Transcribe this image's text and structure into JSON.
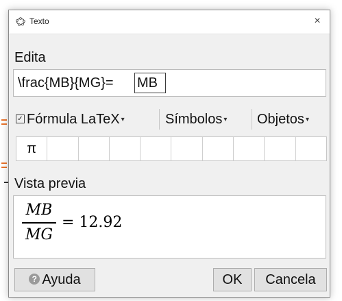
{
  "window": {
    "title": "Texto",
    "close_symbol": "×"
  },
  "edit": {
    "label": "Edita",
    "latex_text": "\\frac{MB}{MG}=",
    "object_text": "MB"
  },
  "toolbar": {
    "latex_checkbox_checked": true,
    "latex_label": "Fórmula LaTeX",
    "symbols_label": "Símbolos",
    "objects_label": "Objetos",
    "caret_symbol": "▾"
  },
  "symbols": [
    "π",
    "",
    "",
    "",
    "",
    "",
    "",
    "",
    "",
    ""
  ],
  "preview": {
    "label": "Vista previa",
    "numerator": "MB",
    "denominator": "MG",
    "rhs": "= 12.92"
  },
  "buttons": {
    "help_label": "Ayuda",
    "ok_label": "OK",
    "cancel_label": "Cancela"
  },
  "icons": {
    "title_icon": "geogebra-icon",
    "help_icon": "question-icon",
    "checkbox_icon": "checkmark-icon"
  }
}
